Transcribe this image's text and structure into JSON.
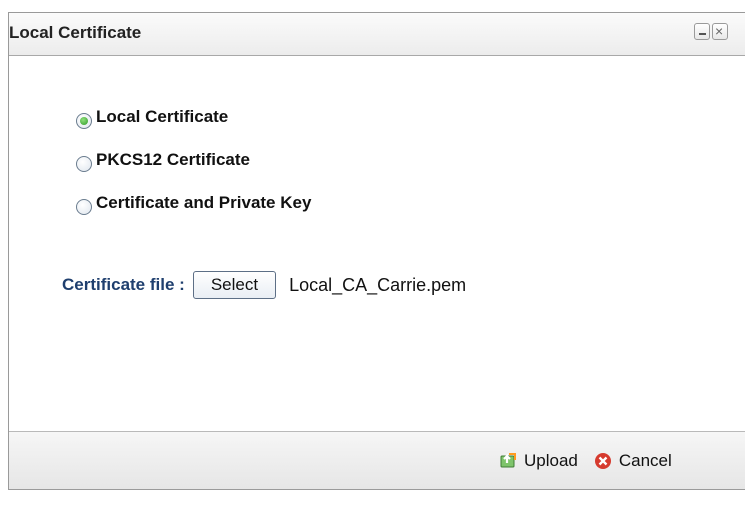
{
  "dialog": {
    "title": "Local Certificate",
    "window_controls": {
      "minimize_icon": "minimize-icon",
      "close_icon": "close-icon"
    }
  },
  "options": [
    {
      "label": "Local Certificate",
      "checked": true
    },
    {
      "label": "PKCS12 Certificate",
      "checked": false
    },
    {
      "label": "Certificate and Private Key",
      "checked": false
    }
  ],
  "certificate": {
    "label": "Certificate file :",
    "select_label": "Select",
    "file_name": "Local_CA_Carrie.pem"
  },
  "footer": {
    "upload_label": "Upload",
    "upload_icon": "upload-icon",
    "cancel_label": "Cancel",
    "cancel_icon": "cancel-icon"
  },
  "colors": {
    "label_blue": "#1f3f6e",
    "radio_checked": "#2f9a2a",
    "cancel_red": "#d63b2f",
    "upload_green": "#3f9c35"
  }
}
